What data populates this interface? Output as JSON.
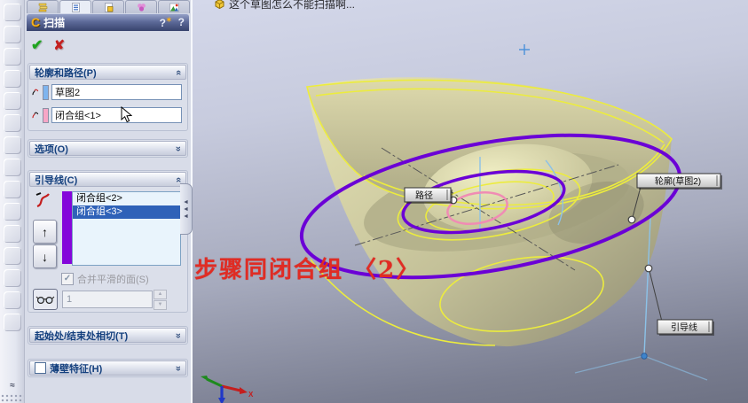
{
  "colors": {
    "guide_curve_purple": "#6b00d6",
    "sketch_yellow": "#ecec3e",
    "path_pink": "#f08cb4",
    "annotation_red": "#e02c24",
    "selection_blue": "#2f62b8"
  },
  "message_bar": {
    "text": "这个草图怎么不能扫描啊..."
  },
  "panel": {
    "title": "扫描",
    "icons": {
      "ok": "✔",
      "cancel": "✘",
      "whats_new": "?",
      "help": "?",
      "chevron": "«",
      "move_up": "↑",
      "move_down": "↓",
      "spin_up": "▲",
      "spin_down": "▼",
      "flyout_arrow": "◄",
      "checkmark": "✓",
      "resize_handle": "≈"
    },
    "groups": {
      "profile_path": {
        "label": "轮廓和路径(P)",
        "profile_value": "草图2",
        "path_value": "闭合组<1>"
      },
      "options": {
        "label": "选项(O)"
      },
      "guide_curves": {
        "label": "引导线(C)",
        "items": [
          {
            "label": "闭合组<2>"
          },
          {
            "label": "闭合组<3>"
          }
        ],
        "merge_faces_label": "合并平滑的面(S)",
        "sections_value": "1"
      },
      "start_end_tangency": {
        "label": "起始处/结束处相切(T)"
      },
      "thin_feature": {
        "label": "薄壁特征(H)"
      }
    }
  },
  "viewport": {
    "callouts": {
      "path": "路径",
      "profile": "轮廓(草图2)",
      "guide": "引导线"
    },
    "annotation": "步骤同闭合组 〈2〉",
    "triad_x_label": "X"
  }
}
